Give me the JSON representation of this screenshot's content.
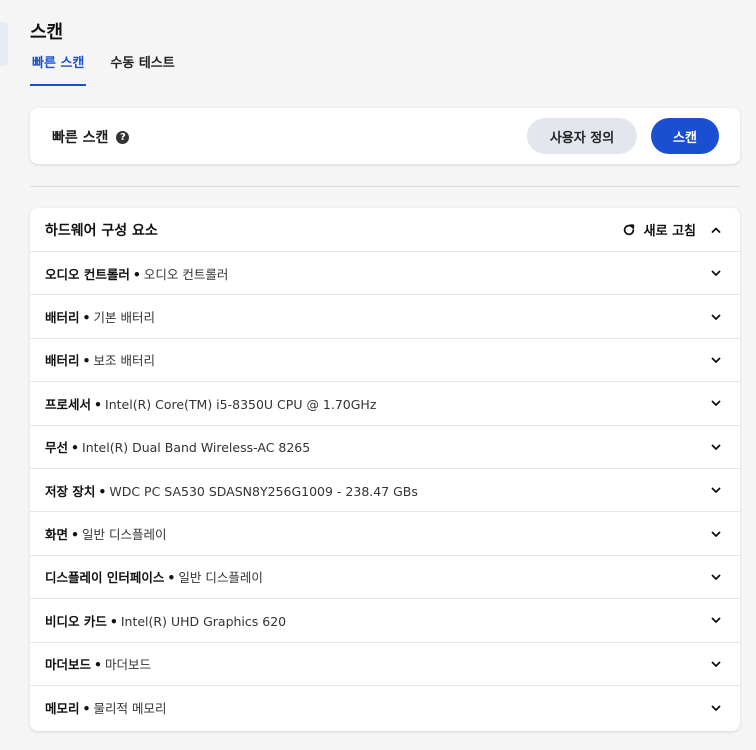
{
  "page": {
    "title": "스캔"
  },
  "tabs": [
    {
      "label": "빠른 스캔",
      "active": true
    },
    {
      "label": "수동 테스트",
      "active": false
    }
  ],
  "quick_scan": {
    "title": "빠른 스캔",
    "help_icon": "question-circle-icon",
    "custom_button": "사용자 정의",
    "scan_button": "스캔"
  },
  "hardware": {
    "title": "하드웨어 구성 요소",
    "refresh_label": "새로 고침",
    "refresh_icon": "refresh-icon",
    "collapse_icon": "chevron-up-icon",
    "items": [
      {
        "label": "오디오 컨트롤러",
        "value": "오디오 컨트롤러"
      },
      {
        "label": "배터리",
        "value": "기본 배터리"
      },
      {
        "label": "배터리",
        "value": "보조 배터리"
      },
      {
        "label": "프로세서",
        "value": "Intel(R) Core(TM) i5-8350U CPU @ 1.70GHz"
      },
      {
        "label": "무선",
        "value": "Intel(R) Dual Band Wireless-AC 8265"
      },
      {
        "label": "저장 장치",
        "value": "WDC PC SA530 SDASN8Y256G1009 - 238.47 GBs"
      },
      {
        "label": "화면",
        "value": "일반 디스플레이"
      },
      {
        "label": "디스플레이 인터페이스",
        "value": "일반 디스플레이"
      },
      {
        "label": "비디오 카드",
        "value": "Intel(R) UHD Graphics 620"
      },
      {
        "label": "마더보드",
        "value": "마더보드"
      },
      {
        "label": "메모리",
        "value": "물리적 메모리"
      }
    ],
    "separator": "•"
  },
  "colors": {
    "accent": "#1a4fd1",
    "secondary_button": "#e3e6ec",
    "background": "#f5f5f6"
  }
}
